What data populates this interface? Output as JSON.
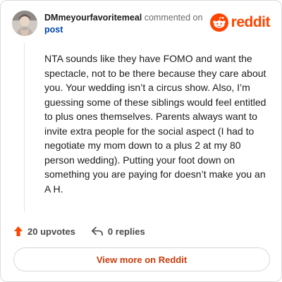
{
  "header": {
    "username": "DMmeyourfavoritemeal",
    "action_text": "commented on",
    "post_link": "post",
    "avatar_icon": "user-avatar-icon",
    "brand_icon": "reddit-logo-icon",
    "brand_name": "reddit"
  },
  "comment": {
    "body": "NTA sounds like they have FOMO and want the spectacle, not to be there because they care about you. Your wedding isn’t a circus show. Also, I’m guessing some of these siblings would feel entitled to plus ones themselves. Parents always want to invite extra people for the social aspect (I had to negotiate my mom down to a plus 2 at my 80 person wedding). Putting your foot down on something you are paying for doesn’t make you an A H."
  },
  "actions": {
    "upvotes_label": "20 upvotes",
    "upvote_icon": "upvote-arrow-icon",
    "replies_label": "0 replies",
    "reply_icon": "reply-arrow-icon"
  },
  "footer": {
    "view_more_label": "View more on Reddit"
  },
  "colors": {
    "brand": "#ff4500",
    "link": "#0045ac",
    "button_text": "#c93b0b"
  }
}
